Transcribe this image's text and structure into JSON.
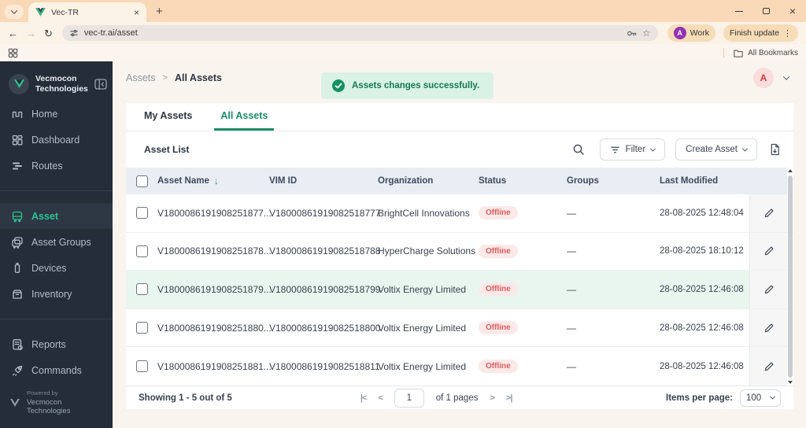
{
  "browser": {
    "tab_title": "Vec-TR",
    "url": "vec-tr.ai/asset",
    "new_tab_icon": "+",
    "tab_close_icon": "×",
    "back_icon": "←",
    "forward_icon": "→",
    "reload_icon": "↻",
    "star_icon": "☆",
    "kebab_icon": "⋮",
    "window_close_icon": "×",
    "profile_label": "Work",
    "profile_avatar_initial": "A",
    "update_button_label": "Finish update",
    "bookmarks_bar_label": "All Bookmarks"
  },
  "sidebar": {
    "brand_line1": "Vecmocon",
    "brand_line2": "Technologies",
    "items": [
      {
        "label": "Home",
        "icon": "home-icon",
        "active": false,
        "divider_before": false
      },
      {
        "label": "Dashboard",
        "icon": "dashboard-icon",
        "active": false,
        "divider_before": false
      },
      {
        "label": "Routes",
        "icon": "routes-icon",
        "active": false,
        "divider_before": false
      },
      {
        "label": "Asset",
        "icon": "asset-icon",
        "active": true,
        "divider_before": true
      },
      {
        "label": "Asset Groups",
        "icon": "asset-groups-icon",
        "active": false,
        "divider_before": false
      },
      {
        "label": "Devices",
        "icon": "devices-icon",
        "active": false,
        "divider_before": false
      },
      {
        "label": "Inventory",
        "icon": "inventory-icon",
        "active": false,
        "divider_before": false
      },
      {
        "label": "Reports",
        "icon": "reports-icon",
        "active": false,
        "divider_before": true
      },
      {
        "label": "Commands",
        "icon": "commands-icon",
        "active": false,
        "divider_before": false
      }
    ],
    "footer_powered_by": "Powered by",
    "footer_company": "Vecmocon Technologies"
  },
  "header": {
    "breadcrumb_root": "Assets",
    "breadcrumb_separator": ">",
    "breadcrumb_current": "All Assets",
    "avatar_initial": "A"
  },
  "toast": {
    "message": "Assets changes successfully."
  },
  "tabs": [
    {
      "label": "My Assets",
      "active": false
    },
    {
      "label": "All Assets",
      "active": true
    }
  ],
  "list_toolbar": {
    "title": "Asset List",
    "filter_label": "Filter",
    "create_label": "Create Asset"
  },
  "table": {
    "columns": [
      "Asset Name",
      "VIM ID",
      "Organization",
      "Status",
      "Groups",
      "Last Modified"
    ],
    "sort_icon": "↓",
    "rows": [
      {
        "name": "V1800086191908251877...",
        "vim_id": "V18000861919082518777",
        "organization": "BrightCell Innovations",
        "status": "Offline",
        "groups": "—",
        "last_modified": "28-08-2025 12:48:04",
        "highlight": false
      },
      {
        "name": "V1800086191908251878...",
        "vim_id": "V18000861919082518788",
        "organization": "HyperCharge Solutions",
        "status": "Offline",
        "groups": "—",
        "last_modified": "28-08-2025 18:10:12",
        "highlight": false
      },
      {
        "name": "V1800086191908251879...",
        "vim_id": "V18000861919082518799",
        "organization": "Voltix Energy Limited",
        "status": "Offline",
        "groups": "—",
        "last_modified": "28-08-2025 12:46:08",
        "highlight": true
      },
      {
        "name": "V1800086191908251880...",
        "vim_id": "V18000861919082518800",
        "organization": "Voltix Energy Limited",
        "status": "Offline",
        "groups": "—",
        "last_modified": "28-08-2025 12:46:08",
        "highlight": false
      },
      {
        "name": "V1800086191908251881...",
        "vim_id": "V18000861919082518811",
        "organization": "Voltix Energy Limited",
        "status": "Offline",
        "groups": "—",
        "last_modified": "28-08-2025 12:46:08",
        "highlight": false
      }
    ]
  },
  "pagination": {
    "summary": "Showing 1 - 5 out of 5",
    "first_icon": "|<",
    "prev_icon": "<",
    "page_value": "1",
    "pages_label": "of 1 pages",
    "next_icon": ">",
    "last_icon": ">|",
    "items_per_page_label": "Items per page:",
    "items_per_page_value": "100"
  },
  "colors": {
    "accent_green": "#1c8c6a",
    "sidebar_active": "#2ec28e",
    "toast_bg": "#d9f2e4",
    "toast_text": "#157a52",
    "offline_bg": "#fbe9e9",
    "offline_text": "#e05b5b",
    "table_header_bg": "#e9edf4",
    "row_highlight_bg": "#e9f6ef",
    "avatar_bg": "#f9dcdc",
    "avatar_text": "#d03c3c"
  }
}
